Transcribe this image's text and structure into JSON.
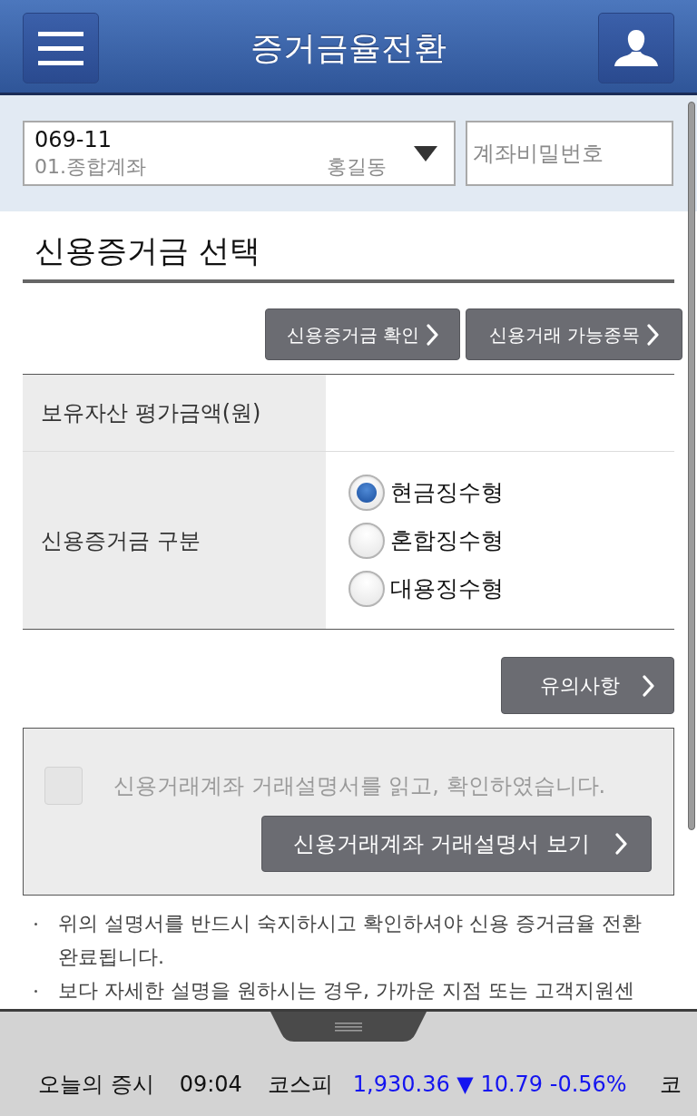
{
  "header": {
    "title": "증거금율전환"
  },
  "account": {
    "number": "069-11",
    "type": "01.종합계좌",
    "owner": "홍길동",
    "password_placeholder": "계좌비밀번호"
  },
  "section": {
    "title": "신용증거금 선택",
    "buttons": [
      "신용증거금 확인",
      "신용거래 가능종목"
    ]
  },
  "form": {
    "rows": [
      {
        "kind": "value",
        "label": "보유자산 평가금액(원)"
      },
      {
        "kind": "radio",
        "label": "신용증거금 구분",
        "options": [
          {
            "label": "현금징수형",
            "selected": true
          },
          {
            "label": "혼합징수형",
            "selected": false
          },
          {
            "label": "대용징수형",
            "selected": false
          }
        ]
      }
    ]
  },
  "notice_button": "유의사항",
  "agreement": {
    "text": "신용거래계좌 거래설명서를 읽고, 확인하였습니다.",
    "checked": false,
    "disabled": true,
    "button": "신용거래계좌 거래설명서 보기"
  },
  "notes": [
    {
      "lines": [
        "위의 설명서를 반드시 숙지하시고 확인하셔야 신용 증거금율 전환",
        "완료됩니다."
      ]
    },
    {
      "lines": [
        "보다 자세한 설명을 원하시는 경우, 가까운 지점 또는 고객지원센"
      ]
    }
  ],
  "ticker": {
    "label": "오늘의 증시",
    "time": "09:04",
    "items": [
      {
        "name": "코스피",
        "quote": "1,930.36 ▼ 10.79 -0.56%",
        "color": "#1414f0"
      },
      {
        "name": "코"
      }
    ]
  }
}
